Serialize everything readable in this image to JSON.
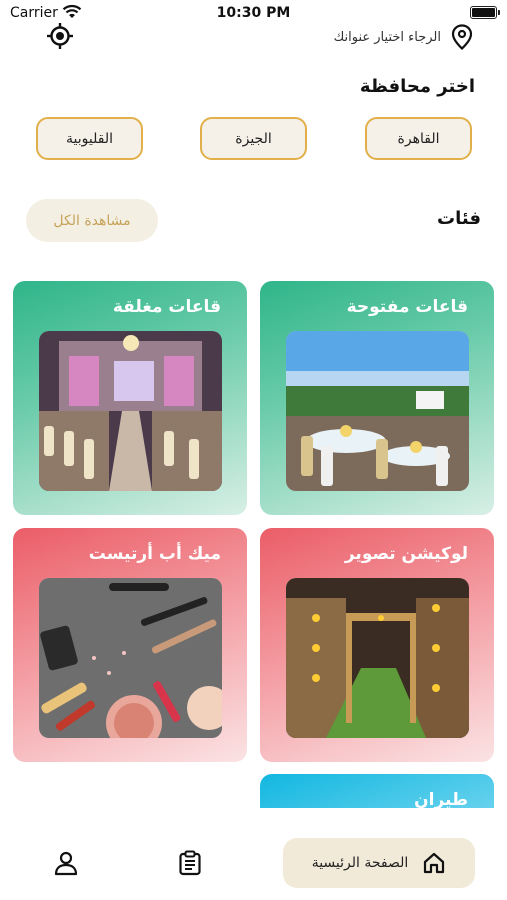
{
  "status_bar": {
    "carrier": "Carrier",
    "time": "10:30 PM"
  },
  "header": {
    "address_prompt": "الرجاء اختيار عنوانك"
  },
  "governorates": {
    "title": "اختر محافظة",
    "items": [
      "القاهرة",
      "الجيزة",
      "القليوبية"
    ]
  },
  "categories": {
    "title": "فئات",
    "view_all": "مشاهدة الكل",
    "items": [
      {
        "title": "قاعات مفتوحة"
      },
      {
        "title": "قاعات مغلقة"
      },
      {
        "title": "لوكيشن تصوير"
      },
      {
        "title": "ميك أب أرتيست"
      },
      {
        "title": "طيران"
      }
    ]
  },
  "bottom_nav": {
    "home_label": "الصفحة الرئيسية"
  },
  "colors": {
    "accent": "#e2b04a",
    "green_card": "#2fb589",
    "pink_card": "#eb5d67",
    "blue_card": "#12b7e0"
  }
}
